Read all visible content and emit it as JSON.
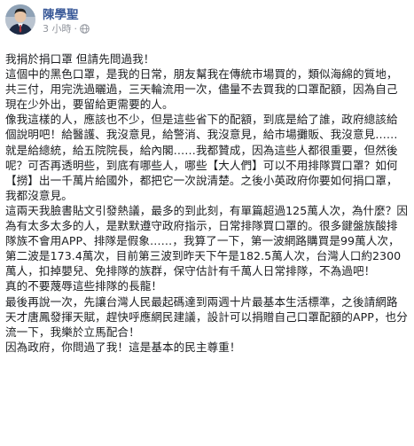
{
  "post": {
    "author": "陳學聖",
    "timestamp": "3 小時",
    "separator": "·",
    "privacy_icon": "globe-icon",
    "paragraphs": [
      "我捐於捐口罩 但請先問過我！",
      "這個中的黑色口罩，是我的日常，朋友幫我在傳統市場買的，類似海綿的質地，共三付，用完洗過曬過，三天輪流用一次，儘量不去買我的口罩配額，因為自己現在少外出，要留給更需要的人。",
      "像我這樣的人，應該也不少，但是這些省下的配額，到底是給了誰，政府總該給個說明吧！給醫護、我沒意見，給警消、我沒意見，給市場攤販、我沒意見……就是給總統，給五院院長，給內閣……我都贊成，因為這些人都很重要，但然後呢？可否再透明些，到底有哪些人，哪些【大人們】可以不用排隊買口罩？如何【撈】出一千萬片給國外，都把它一次說清楚。之後小英政府你要如何捐口罩，我都沒意見。",
      "這兩天我臉書貼文引發熱議，最多的到此刻，有單篇超過125萬人次，為什麼？因為有太多太多的人，是默默遵守政府指示，日常排隊買口罩的。很多鍵盤族酸排隊族不會用APP、排隊是假象……，我算了一下，第一波網路購買是99萬人次，第二波是173.4萬次，目前第三波到昨天下午是182.5萬人次，台灣人口約2300萬人，扣掉嬰兒、免排隊的族群，保守估計有千萬人日常排隊，不為過吧！",
      "真的不要蔑辱這些排隊的長龍！",
      "最後再說一次，先讓台灣人民最起碼達到兩週十片最基本生活標準，之後請網路天才唐鳳發揮天賦，趕快呼應網民建議，設計可以捐贈自己口罩配額的APP，也分流一下，我樂於立馬配合！",
      "因為政府，你問過了我！這是基本的民主尊重！"
    ]
  },
  "colors": {
    "author": "#385898",
    "meta": "#90949c",
    "text": "#1c1e21"
  }
}
